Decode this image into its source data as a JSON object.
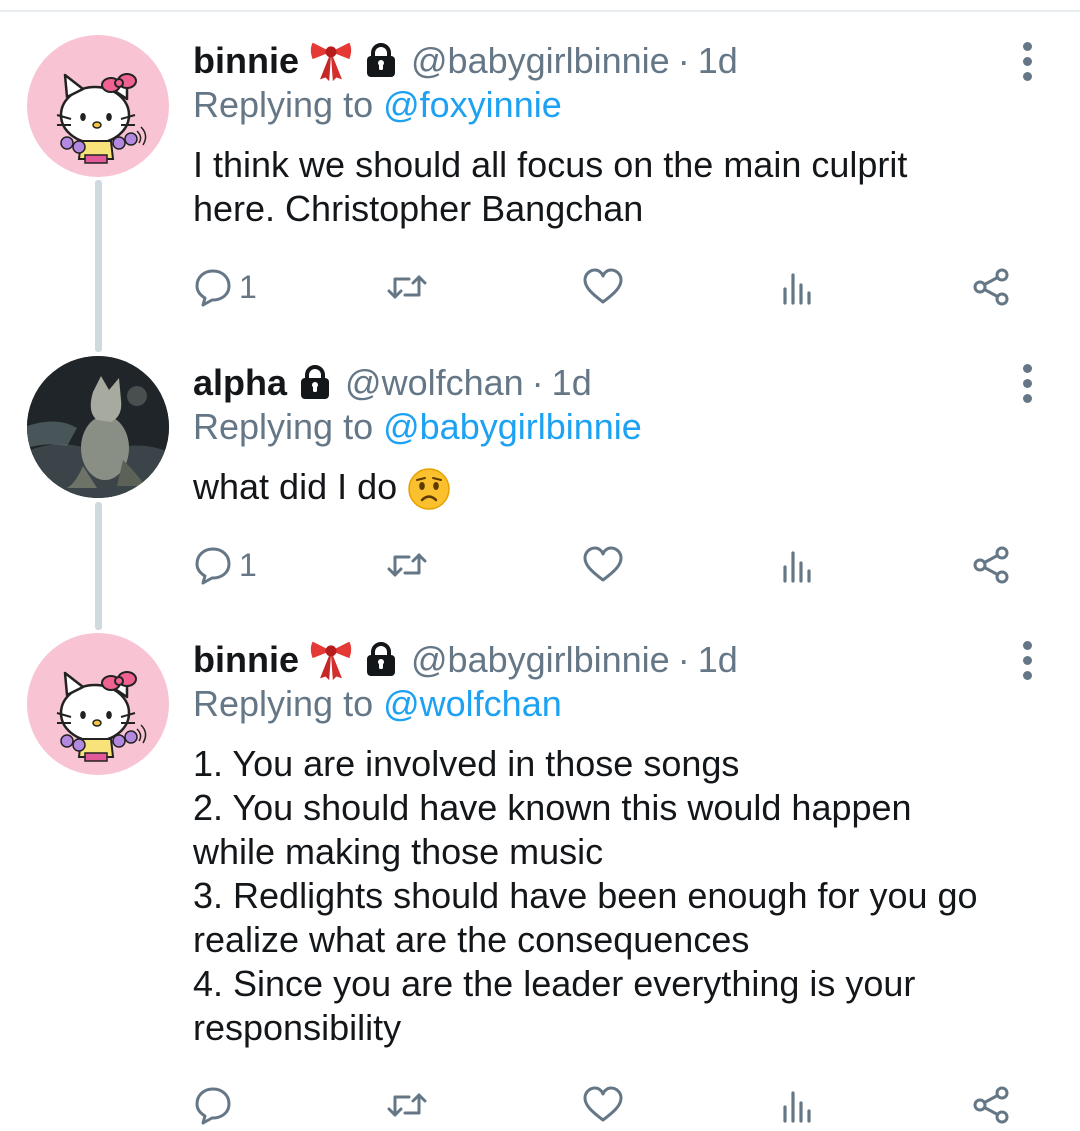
{
  "tweets": [
    {
      "display_name": "binnie",
      "handle": "@babygirlbinnie",
      "separator": "·",
      "time": "1d",
      "reply_prefix": "Replying to ",
      "reply_to": "@foxyinnie",
      "text_lines": [
        "I think we should all focus on the main culprit",
        "here. Christopher Bangchan"
      ],
      "reply_count": "1",
      "avatar": "hello-kitty-avatar",
      "emojis": [
        "ribbon-emoji",
        "lock-icon"
      ]
    },
    {
      "display_name": "alpha",
      "handle": "@wolfchan",
      "separator": "·",
      "time": "1d",
      "reply_prefix": "Replying to ",
      "reply_to": "@babygirlbinnie",
      "text_lines": [
        "what did I do"
      ],
      "reply_count": "1",
      "avatar": "wolf-avatar",
      "emojis": [
        "lock-icon",
        "worried-face-emoji"
      ]
    },
    {
      "display_name": "binnie",
      "handle": "@babygirlbinnie",
      "separator": "·",
      "time": "1d",
      "reply_prefix": "Replying to ",
      "reply_to": "@wolfchan",
      "text_lines": [
        "1. You are involved in those songs",
        "2. You should have known this would happen",
        "while making those music",
        "3. Redlights should have been enough for you go",
        "realize what are the consequences",
        "4. Since you are the leader everything is your",
        "responsibility"
      ],
      "reply_count": "",
      "avatar": "hello-kitty-avatar",
      "emojis": [
        "ribbon-emoji",
        "lock-icon"
      ]
    }
  ],
  "icons": [
    "reply-icon",
    "retweet-icon",
    "like-icon",
    "analytics-icon",
    "share-icon",
    "more-options-icon"
  ],
  "colors": {
    "mention": "#1da1f2",
    "muted": "#657786",
    "text": "#14171a",
    "avatar_pink": "#f8c4d3",
    "thread_line": "#cfd9de"
  }
}
